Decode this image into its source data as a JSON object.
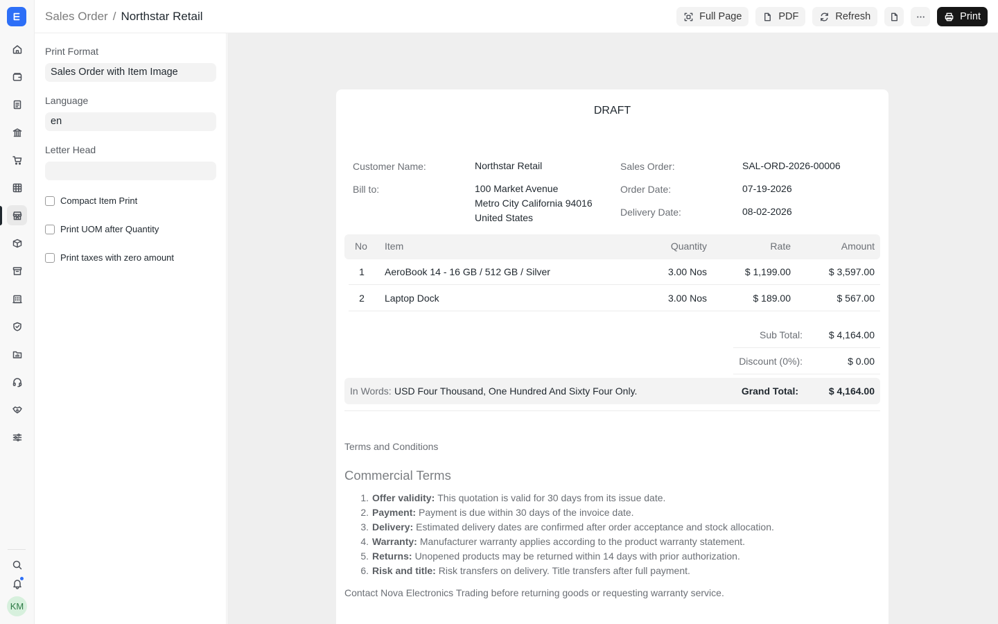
{
  "breadcrumb": {
    "parent": "Sales Order",
    "separator": "/",
    "current": "Northstar Retail"
  },
  "toolbar": {
    "full_page": "Full Page",
    "pdf": "PDF",
    "refresh": "Refresh",
    "print": "Print"
  },
  "rail": {
    "logo": "E",
    "icons": [
      "home-icon",
      "wallet-icon",
      "document-icon",
      "bank-icon",
      "cart-icon",
      "table-icon",
      "store-icon",
      "box-icon",
      "archive-icon",
      "building-icon",
      "shield-icon",
      "folder-chart-icon",
      "headset-icon",
      "handshake-icon",
      "sliders-icon"
    ],
    "active_index": 6,
    "avatar_initials": "KM"
  },
  "settings": {
    "print_format_label": "Print Format",
    "print_format_value": "Sales Order with Item Image",
    "language_label": "Language",
    "language_value": "en",
    "letter_head_label": "Letter Head",
    "letter_head_value": "",
    "checks": [
      "Compact Item Print",
      "Print UOM after Quantity",
      "Print taxes with zero amount"
    ]
  },
  "doc": {
    "status": "DRAFT",
    "customer_name_label": "Customer Name:",
    "customer_name": "Northstar Retail",
    "bill_to_label": "Bill to:",
    "bill_to": [
      "100 Market Avenue",
      "Metro City California 94016",
      "United States"
    ],
    "sales_order_label": "Sales Order:",
    "sales_order": "SAL-ORD-2026-00006",
    "order_date_label": "Order Date:",
    "order_date": "07-19-2026",
    "delivery_date_label": "Delivery Date:",
    "delivery_date": "08-02-2026",
    "columns": {
      "no": "No",
      "item": "Item",
      "quantity": "Quantity",
      "rate": "Rate",
      "amount": "Amount"
    },
    "items": [
      {
        "no": "1",
        "item": "AeroBook 14 - 16 GB / 512 GB / Silver",
        "quantity": "3.00 Nos",
        "rate": "$ 1,199.00",
        "amount": "$ 3,597.00"
      },
      {
        "no": "2",
        "item": "Laptop Dock",
        "quantity": "3.00 Nos",
        "rate": "$ 189.00",
        "amount": "$ 567.00"
      }
    ],
    "sub_total_label": "Sub Total:",
    "sub_total": "$ 4,164.00",
    "discount_label": "Discount (0%):",
    "discount": "$ 0.00",
    "in_words_label": "In Words:",
    "in_words": "USD Four Thousand, One Hundred And Sixty Four Only.",
    "grand_total_label": "Grand Total:",
    "grand_total": "$ 4,164.00",
    "terms_title": "Terms and Conditions",
    "terms_heading": "Commercial Terms",
    "terms": [
      {
        "num": "1.",
        "title": "Offer validity:",
        "text": "This quotation is valid for 30 days from its issue date."
      },
      {
        "num": "2.",
        "title": "Payment:",
        "text": "Payment is due within 30 days of the invoice date."
      },
      {
        "num": "3.",
        "title": "Delivery:",
        "text": "Estimated delivery dates are confirmed after order acceptance and stock allocation."
      },
      {
        "num": "4.",
        "title": "Warranty:",
        "text": "Manufacturer warranty applies according to the product warranty statement."
      },
      {
        "num": "5.",
        "title": "Returns:",
        "text": "Unopened products may be returned within 14 days with prior authorization."
      },
      {
        "num": "6.",
        "title": "Risk and title:",
        "text": "Risk transfers on delivery. Title transfers after full payment."
      }
    ],
    "contact": "Contact Nova Electronics Trading before returning goods or requesting warranty service."
  }
}
